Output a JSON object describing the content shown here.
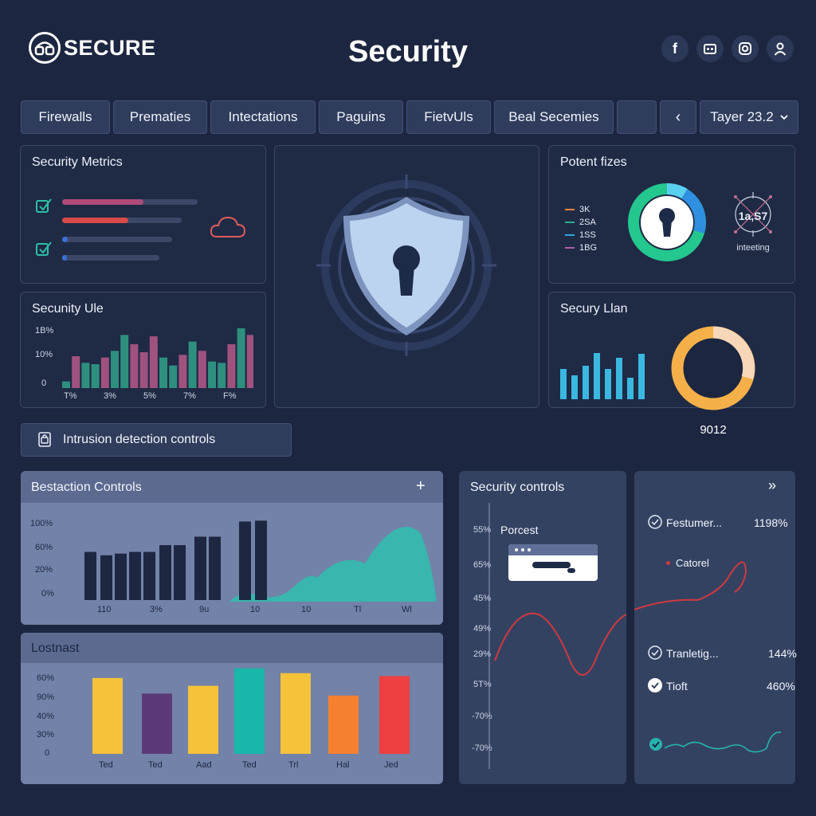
{
  "header": {
    "logo_text": "SECURE",
    "title": "Security"
  },
  "tabs": [
    {
      "label": "Firewalls"
    },
    {
      "label": "Prematies"
    },
    {
      "label": "Intectations"
    },
    {
      "label": "Paguins"
    },
    {
      "label": "FietvUls"
    },
    {
      "label": "Beal Secemies"
    },
    {
      "label": ""
    },
    {
      "label": "‹"
    },
    {
      "label": "Tayer 23.2"
    }
  ],
  "metrics_panel": {
    "title": "Security Metrics",
    "meters": [
      {
        "fill": 0.6,
        "color": "#b04a78"
      },
      {
        "fill": 0.55,
        "color": "#d94a4a"
      },
      {
        "fill": 0.05,
        "color": "#3d6fd8"
      },
      {
        "fill": 0.05,
        "color": "#3d6fd8"
      }
    ],
    "colors": {
      "check": "#2bbfa4",
      "cloud": "#e05b5b"
    }
  },
  "potent_panel": {
    "title": "Potent fizes",
    "legend": [
      {
        "label": "3K",
        "color": "#e8843a"
      },
      {
        "label": "2SA",
        "color": "#2fae8e"
      },
      {
        "label": "1SS",
        "color": "#2fa7d8"
      },
      {
        "label": "1BG",
        "color": "#b05fb0"
      }
    ],
    "gauge_label": "1a,S7",
    "gauge_caption": "inteeting"
  },
  "unity_chart": {
    "title": "Secunity Ule",
    "y_ticks": [
      "1B%",
      "10%",
      "0"
    ],
    "x_ticks": [
      "T%",
      "3%",
      "5%",
      "7%",
      "F%"
    ],
    "values": [
      5,
      24,
      19,
      18,
      23,
      28,
      40,
      33,
      27,
      39,
      23,
      17,
      25,
      35,
      28,
      20,
      19,
      33,
      45,
      40
    ],
    "colors": [
      "#2e8f7f",
      "#a0527f",
      "#2e8f7f",
      "#2e8f7f",
      "#a0527f",
      "#2e8f7f",
      "#2e8f7f",
      "#a0527f",
      "#a0527f",
      "#a0527f",
      "#2e8f7f",
      "#2e8f7f",
      "#a0527f",
      "#2e8f7f",
      "#a0527f",
      "#2e8f7f",
      "#2e8f7f",
      "#a0527f",
      "#2e8f7f",
      "#a0527f"
    ]
  },
  "shield_panel": {
    "colors": {
      "shield": "#bcd4ef",
      "keyhole": "#1e2b48"
    }
  },
  "lan_panel": {
    "title": "Secury Llan",
    "bars": [
      38,
      30,
      42,
      58,
      38,
      52,
      27,
      57
    ],
    "bar_color": "#3ab8e0",
    "donut_value": "9012",
    "donut_colors": [
      "#f5b04a",
      "#f7d7b8"
    ]
  },
  "intrusion": {
    "label": "Intrusion detection controls"
  },
  "bestaction_chart": {
    "title": "Bestaction Controls",
    "add_icon": "+",
    "y_ticks": [
      "100%",
      "60%",
      "20%",
      "0%"
    ],
    "x_ticks": [
      "110",
      "3%",
      "9u",
      "10",
      "10",
      "Tl",
      "Wl"
    ],
    "values": [
      57,
      53,
      55,
      57,
      57,
      65,
      65,
      75,
      75,
      93,
      94
    ],
    "area_color": "#2fbfae"
  },
  "lostnast_chart": {
    "title": "Lostnast",
    "y_ticks": [
      "60%",
      "90%",
      "40%",
      "30%",
      "0"
    ],
    "x_ticks": [
      "Ted",
      "Ted",
      "Aad",
      "Ted",
      "Trl",
      "Hal",
      "Jed"
    ],
    "values": [
      78,
      62,
      70,
      88,
      83,
      60,
      80
    ],
    "colors": [
      "#f5c23a",
      "#5c3a7a",
      "#f5c23a",
      "#19b6aa",
      "#f5c23a",
      "#f58030",
      "#ee4040"
    ]
  },
  "controls_panel": {
    "title": "Security controls",
    "y_ticks": [
      "55%",
      "65%",
      "45%",
      "49%",
      "29%",
      "5T%",
      "-70%",
      "-70%"
    ],
    "popup_label": "Porcest",
    "line_color": "#d0393e"
  },
  "side_panel": {
    "expand_icon": "»",
    "rows": [
      {
        "label": "Festumer...",
        "value": "1198%"
      },
      {
        "label": "Catorel",
        "value": ""
      },
      {
        "label": "Tranletig...",
        "value": "144%"
      },
      {
        "label": "Tioft",
        "value": "460%"
      }
    ],
    "colors": {
      "red_line": "#d0393e",
      "teal_line": "#26b3ac"
    }
  }
}
